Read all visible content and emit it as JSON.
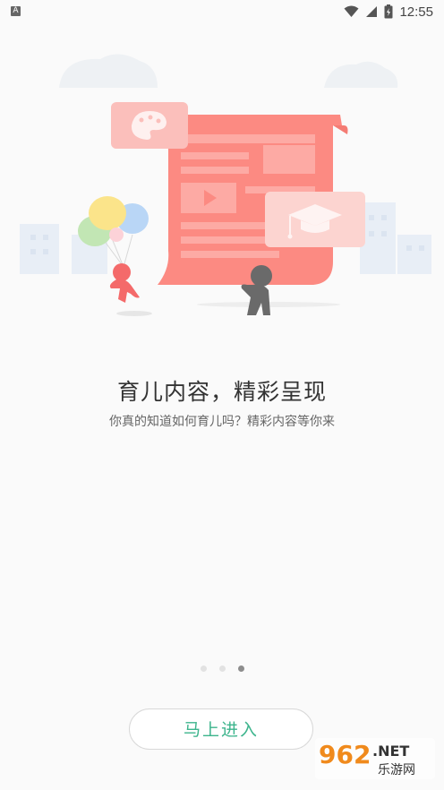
{
  "status_bar": {
    "notification_badge": "A",
    "time": "12:55",
    "icons": [
      "wifi-icon",
      "signal-icon",
      "battery-icon"
    ]
  },
  "onboarding": {
    "title": "育儿内容，精彩呈现",
    "subtitle": "你真的知道如何育儿吗？精彩内容等你来",
    "page_indicator": {
      "total": 3,
      "current": 3
    },
    "enter_button_label": "马上进入"
  },
  "watermark": {
    "number": "962",
    "suffix": ".NET",
    "site_name": "乐游网"
  },
  "colors": {
    "accent": "#3cb48c",
    "illustration_red": "#fc8a82",
    "indicator_active": "#8d8d8d",
    "indicator_inactive": "#e2e2e2"
  }
}
